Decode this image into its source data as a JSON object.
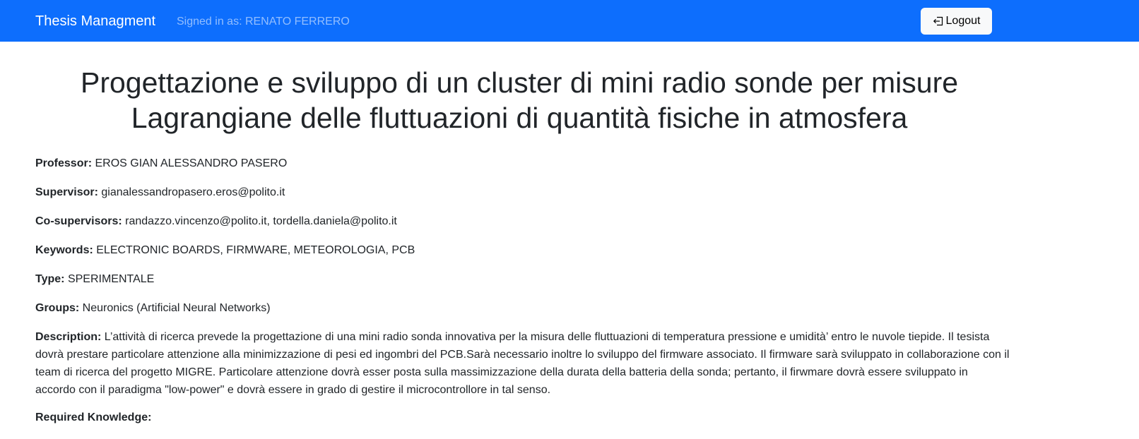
{
  "navbar": {
    "brand": "Thesis Managment",
    "signed_in": "Signed in as: RENATO FERRERO",
    "logout_label": "Logout",
    "color": "#0d6efd"
  },
  "thesis": {
    "title": "Progettazione e sviluppo di un cluster di mini radio sonde per misure Lagrangiane delle fluttuazioni di quantità fisiche in atmosfera",
    "fields": {
      "professor": {
        "label": "Professor:",
        "value": "EROS GIAN ALESSANDRO PASERO"
      },
      "supervisor": {
        "label": "Supervisor:",
        "value": "gianalessandropasero.eros@polito.it"
      },
      "co_supervisors": {
        "label": "Co-supervisors:",
        "value": "randazzo.vincenzo@polito.it, tordella.daniela@polito.it"
      },
      "keywords": {
        "label": "Keywords:",
        "value": "ELECTRONIC BOARDS, FIRMWARE, METEOROLOGIA, PCB"
      },
      "type": {
        "label": "Type:",
        "value": "SPERIMENTALE"
      },
      "groups": {
        "label": "Groups:",
        "value": "Neuronics (Artificial Neural Networks)"
      },
      "description": {
        "label": "Description:",
        "value": "L’attività di ricerca prevede la progettazione di una mini radio sonda innovativa per la misura delle fluttuazioni di temperatura pressione e umidità’ entro le nuvole tiepide. Il tesista dovrà prestare particolare attenzione alla minimizzazione di pesi ed ingombri del PCB.Sarà necessario inoltre lo sviluppo del firmware associato. Il firmware sarà sviluppato in collaborazione con il team di ricerca del progetto MIGRE. Particolare attenzione dovrà esser posta sulla massimizzazione della durata della batteria della sonda; pertanto, il firwmare dovrà essere sviluppato in accordo con il paradigma \"low-power\" e dovrà essere in grado di gestire il microcontrollore in tal senso."
      },
      "required_knowledge": {
        "label": "Required Knowledge:"
      }
    }
  }
}
